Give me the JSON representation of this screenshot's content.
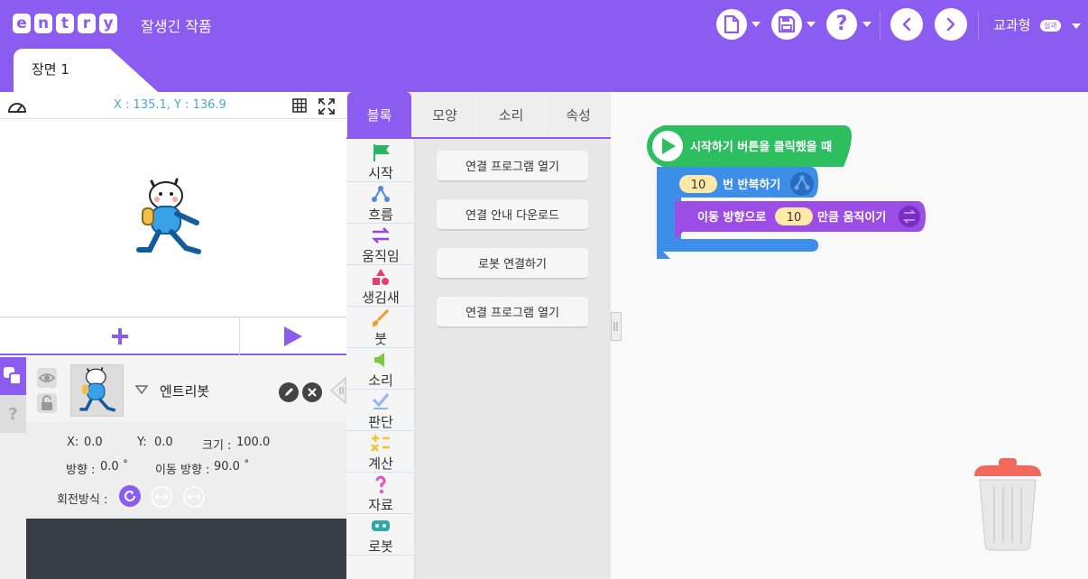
{
  "header": {
    "logo_letters": [
      "e",
      "n",
      "t",
      "r",
      "y"
    ],
    "project_title": "잘생긴 작품",
    "mode_label": "교과형",
    "mode_badge": "실과",
    "accent_color": "#8c5cf0"
  },
  "scene_tab": {
    "label": "장면 1"
  },
  "stage": {
    "coord_text": "X : 135.1, Y : 136.9"
  },
  "object": {
    "name": "엔트리봇",
    "x_label": "X:",
    "x_value": "0.0",
    "y_label": "Y:",
    "y_value": "0.0",
    "size_label": "크기 :",
    "size_value": "100.0",
    "direction_label": "방향 :",
    "direction_value": "0.0 ˚",
    "move_dir_label": "이동 방향 :",
    "move_dir_value": "90.0 ˚",
    "rotation_label": "회전방식 :"
  },
  "help_tab_label": "?",
  "block_tabs": [
    "블록",
    "모양",
    "소리",
    "속성"
  ],
  "categories": [
    {
      "label": "시작",
      "icon": "flag-icon",
      "color": "#29b660"
    },
    {
      "label": "흐름",
      "icon": "flow-icon",
      "color": "#4d8bd9"
    },
    {
      "label": "움직임",
      "icon": "move-arrows-icon",
      "color": "#9b45dc"
    },
    {
      "label": "생김새",
      "icon": "shapes-icon",
      "color": "#e63d6b"
    },
    {
      "label": "붓",
      "icon": "brush-icon",
      "color": "#f59a25"
    },
    {
      "label": "소리",
      "icon": "speaker-icon",
      "color": "#7ac942"
    },
    {
      "label": "판단",
      "icon": "check-icon",
      "color": "#8cb6f4"
    },
    {
      "label": "계산",
      "icon": "calc-icon",
      "color": "#f6c42e"
    },
    {
      "label": "자료",
      "icon": "question-icon",
      "color": "#e34ec9"
    },
    {
      "label": "로봇",
      "icon": "robot-icon",
      "color": "#2fa8a8"
    }
  ],
  "palette_blocks": [
    "연결 프로그램 열기",
    "연결 안내 다운로드",
    "로봇 연결하기",
    "연결 프로그램 열기"
  ],
  "script": {
    "start_block": "시작하기 버튼을 클릭했을 때",
    "repeat_value": "10",
    "repeat_label": "번 반복하기",
    "move_label_before": "이동 방향으로",
    "move_value": "10",
    "move_label_after": "만큼 움직이기",
    "start_color": "#2dbe60",
    "flow_color": "#3d8ee8",
    "move_color": "#9b4de6"
  }
}
